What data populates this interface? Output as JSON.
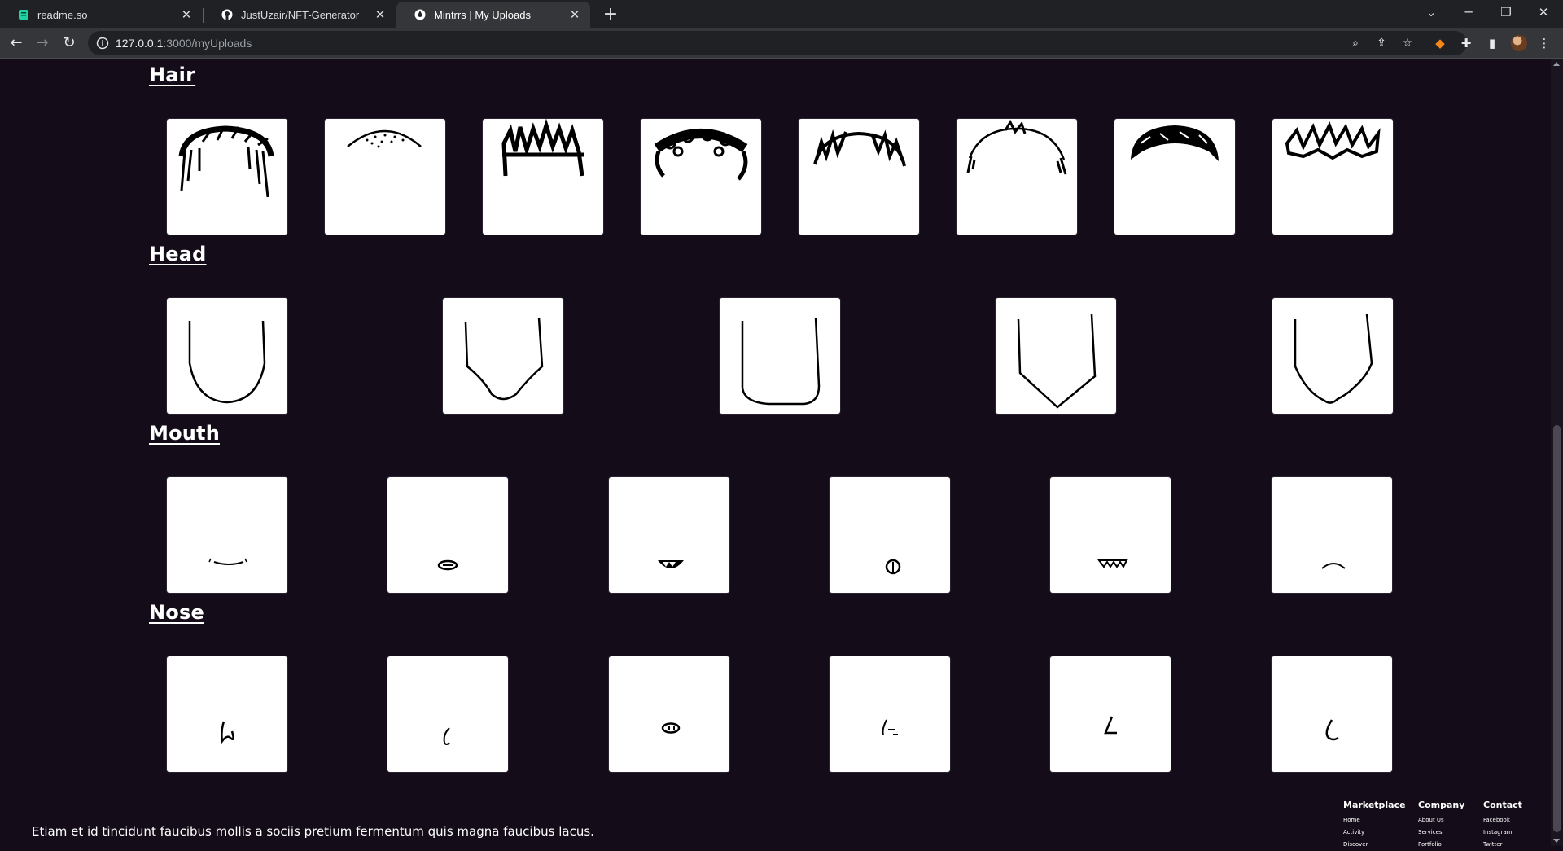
{
  "browser": {
    "tabs": [
      {
        "label": "readme.so",
        "icon": "readme-favicon-icon",
        "color": "#1dd1a1"
      },
      {
        "label": "JustUzair/NFT-Generator",
        "icon": "github-icon",
        "color": "#ffffff"
      },
      {
        "label": "Mintrrs | My Uploads",
        "icon": "mintrrs-favicon-icon",
        "color": "#ffffff"
      }
    ],
    "url_host": "127.0.0.1",
    "url_path": ":3000/myUploads"
  },
  "sections": [
    {
      "title": "Hair",
      "count": 8
    },
    {
      "title": "Head",
      "count": 5
    },
    {
      "title": "Mouth",
      "count": 6
    },
    {
      "title": "Nose",
      "count": 6
    }
  ],
  "footer": {
    "tagline": "Etiam et id tincidunt faucibus mollis a sociis pretium fermentum quis magna faucibus lacus.",
    "columns": [
      {
        "title": "Marketplace",
        "links": [
          "Home",
          "Activity",
          "Discover"
        ]
      },
      {
        "title": "Company",
        "links": [
          "About Us",
          "Services",
          "Portfolio"
        ]
      },
      {
        "title": "Contact",
        "links": [
          "Facebook",
          "Instagram",
          "Twitter"
        ]
      }
    ]
  },
  "colors": {
    "page_background": "#140d19",
    "card_background": "#ffffff",
    "text": "#ffffff"
  }
}
